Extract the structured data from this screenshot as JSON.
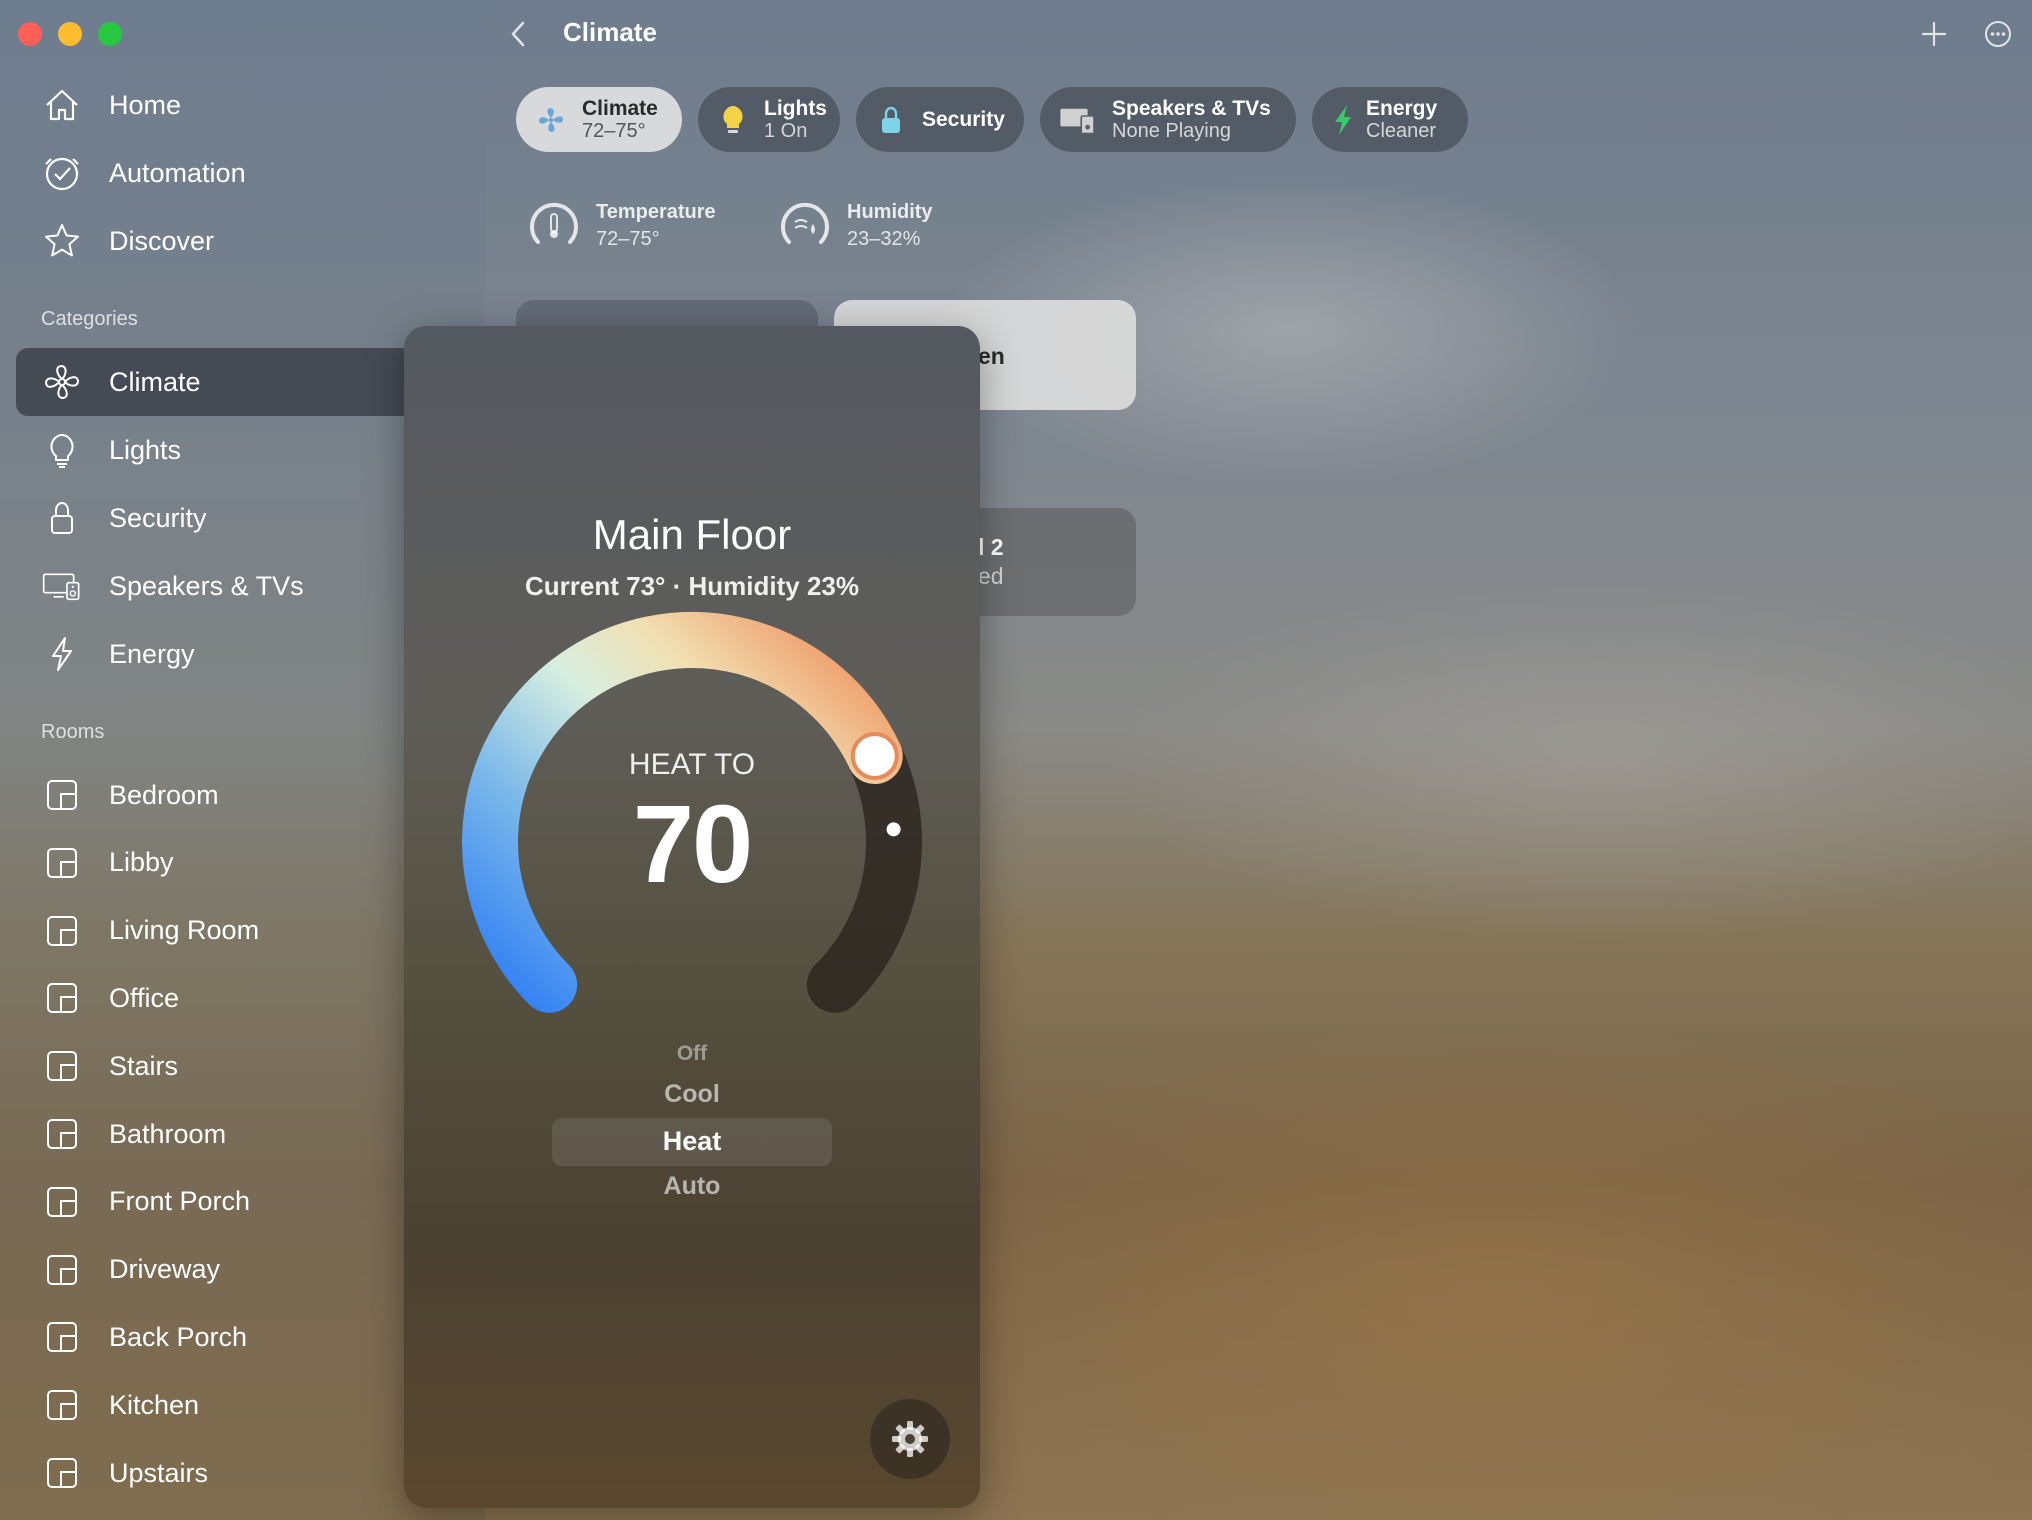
{
  "window": {
    "title": "Climate"
  },
  "sidebar": {
    "nav": [
      {
        "label": "Home",
        "icon": "house-icon"
      },
      {
        "label": "Automation",
        "icon": "clock-check-icon"
      },
      {
        "label": "Discover",
        "icon": "star-icon"
      }
    ],
    "categories_header": "Categories",
    "categories": [
      {
        "label": "Climate",
        "icon": "fan-icon",
        "selected": true
      },
      {
        "label": "Lights",
        "icon": "lightbulb-icon"
      },
      {
        "label": "Security",
        "icon": "lock-icon"
      },
      {
        "label": "Speakers & TVs",
        "icon": "speaker-tv-icon"
      },
      {
        "label": "Energy",
        "icon": "bolt-icon"
      }
    ],
    "rooms_header": "Rooms",
    "rooms": [
      {
        "label": "Bedroom"
      },
      {
        "label": "Libby"
      },
      {
        "label": "Living Room"
      },
      {
        "label": "Office"
      },
      {
        "label": "Stairs"
      },
      {
        "label": "Bathroom"
      },
      {
        "label": "Front Porch"
      },
      {
        "label": "Driveway"
      },
      {
        "label": "Back Porch"
      },
      {
        "label": "Kitchen"
      },
      {
        "label": "Upstairs"
      }
    ]
  },
  "chips": [
    {
      "title": "Climate",
      "subtitle": "72–75°",
      "icon": "fan-icon",
      "active": true,
      "icon_color": "#6aa7d8"
    },
    {
      "title": "Lights",
      "subtitle": "1 On",
      "icon": "lightbulb-icon",
      "icon_color": "#f2d347"
    },
    {
      "title": "Security",
      "subtitle": "",
      "icon": "lock-icon",
      "icon_color": "#7fd3e6"
    },
    {
      "title": "Speakers & TVs",
      "subtitle": "None Playing",
      "icon": "speaker-tv-icon",
      "icon_color": "#e0e0e0"
    },
    {
      "title": "Energy",
      "subtitle": "Cleaner",
      "icon": "bolt-icon",
      "icon_color": "#38c96a"
    }
  ],
  "summary": {
    "temperature": {
      "label": "Temperature",
      "value": "72–75°"
    },
    "humidity": {
      "label": "Humidity",
      "value": "23–32%"
    }
  },
  "tiles": {
    "tile_a_partial": "en",
    "tile_b_line1": "l 2",
    "tile_b_line2": "ed"
  },
  "thermostat": {
    "name": "Main Floor",
    "status": "Current 73° · Humidity 23%",
    "mode_label": "HEAT TO",
    "target": "70",
    "modes": [
      "Off",
      "Cool",
      "Heat",
      "Auto"
    ],
    "selected_mode": "Heat",
    "dial_fraction": 0.74,
    "current_fraction": 0.82
  },
  "colors": {
    "accent_heat": "#e8895a",
    "accent_cool": "#3a86f0"
  }
}
